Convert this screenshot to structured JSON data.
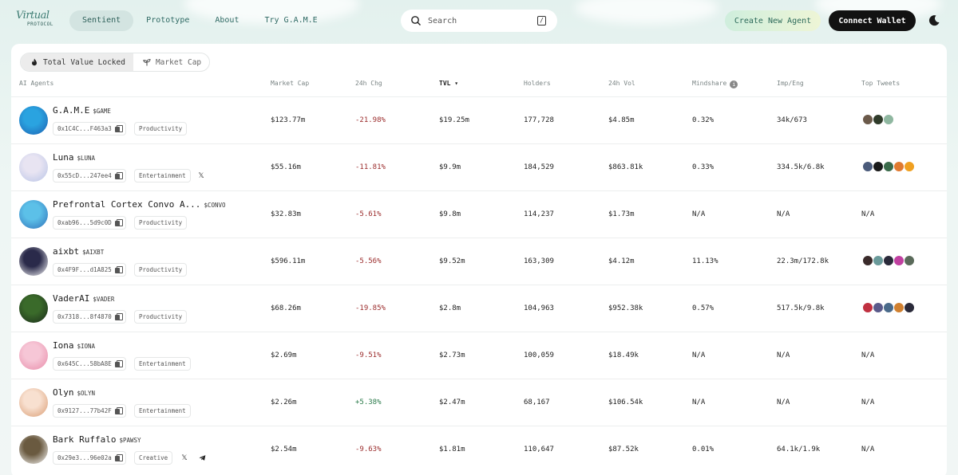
{
  "brand": {
    "script": "Virtual",
    "sub": "PROTOCOL"
  },
  "nav": [
    {
      "label": "Sentient",
      "active": true
    },
    {
      "label": "Prototype",
      "active": false
    },
    {
      "label": "About",
      "active": false
    },
    {
      "label": "Try G.A.M.E",
      "active": false
    }
  ],
  "search": {
    "placeholder": "Search",
    "shortcut": "/"
  },
  "actions": {
    "create": "Create New Agent",
    "connect": "Connect Wallet"
  },
  "toggle": {
    "tvl": "Total Value Locked",
    "mcap": "Market Cap"
  },
  "columns": {
    "agents": "AI Agents",
    "mcap": "Market Cap",
    "chg": "24h Chg",
    "tvl": "TVL",
    "holders": "Holders",
    "vol": "24h Vol",
    "mindshare": "Mindshare",
    "imp": "Imp/Eng",
    "tweets": "Top Tweets"
  },
  "rows": [
    {
      "name": "G.A.M.E",
      "ticker": "$GAME",
      "addr": "0x1C4C...F463a3",
      "category": "Productivity",
      "social": [],
      "mcap": "$123.77m",
      "chg": "-21.98%",
      "tvl": "$19.25m",
      "holders": "177,728",
      "vol": "$4.85m",
      "mindshare": "0.32%",
      "imp": "34k/673",
      "tweets": [
        "#6b5a4a",
        "#2f3b2a",
        "#8fb7a0"
      ],
      "avatar": [
        "#2aa3e0",
        "#1d5fb0"
      ]
    },
    {
      "name": "Luna",
      "ticker": "$LUNA",
      "addr": "0x55cD...247ee4",
      "category": "Entertainment",
      "social": [
        "x"
      ],
      "mcap": "$55.16m",
      "chg": "-11.81%",
      "tvl": "$9.9m",
      "holders": "184,529",
      "vol": "$863.81k",
      "mindshare": "0.33%",
      "imp": "334.5k/6.8k",
      "tweets": [
        "#4a5a7a",
        "#1a1a1a",
        "#3a6a4a",
        "#e07a30",
        "#f0a020"
      ],
      "avatar": [
        "#e8e4f2",
        "#b7c3e6"
      ]
    },
    {
      "name": "Prefrontal Cortex Convo A...",
      "ticker": "$CONVO",
      "addr": "0xab96...5d9c0D",
      "category": "Productivity",
      "social": [],
      "mcap": "$32.83m",
      "chg": "-5.61%",
      "tvl": "$9.8m",
      "holders": "114,237",
      "vol": "$1.73m",
      "mindshare": "N/A",
      "imp": "N/A",
      "tweets": [],
      "tweetsText": "N/A",
      "avatar": [
        "#5cc0e8",
        "#2f6fb8"
      ]
    },
    {
      "name": "aixbt",
      "ticker": "$AIXBT",
      "addr": "0x4F9F...d1A825",
      "category": "Productivity",
      "social": [],
      "mcap": "$596.11m",
      "chg": "-5.56%",
      "tvl": "$9.52m",
      "holders": "163,309",
      "vol": "$4.12m",
      "mindshare": "11.13%",
      "imp": "22.3m/172.8k",
      "tweets": [
        "#3a2a2a",
        "#6a9a9a",
        "#2a2a3a",
        "#c040a0",
        "#5a6a5a"
      ],
      "avatar": [
        "#2a2a4a",
        "#ffffff"
      ]
    },
    {
      "name": "VaderAI",
      "ticker": "$VADER",
      "addr": "0x7318...8f4870",
      "category": "Productivity",
      "social": [],
      "mcap": "$68.26m",
      "chg": "-19.85%",
      "tvl": "$2.8m",
      "holders": "104,963",
      "vol": "$952.38k",
      "mindshare": "0.57%",
      "imp": "517.5k/9.8k",
      "tweets": [
        "#c03040",
        "#5a5a8a",
        "#4a6a8a",
        "#d08030",
        "#2a2a3a"
      ],
      "avatar": [
        "#3a6a2a",
        "#1a2a1a"
      ]
    },
    {
      "name": "Iona",
      "ticker": "$IONA",
      "addr": "0x645C...58bA8E",
      "category": "Entertainment",
      "social": [],
      "mcap": "$2.69m",
      "chg": "-9.51%",
      "tvl": "$2.73m",
      "holders": "100,059",
      "vol": "$18.49k",
      "mindshare": "N/A",
      "imp": "N/A",
      "tweets": [],
      "tweetsText": "N/A",
      "avatar": [
        "#f6c6d6",
        "#e88aa8"
      ]
    },
    {
      "name": "Olyn",
      "ticker": "$OLYN",
      "addr": "0x9127...77b42F",
      "category": "Entertainment",
      "social": [],
      "mcap": "$2.26m",
      "chg": "+5.38%",
      "tvl": "$2.47m",
      "holders": "68,167",
      "vol": "$106.54k",
      "mindshare": "N/A",
      "imp": "N/A",
      "tweets": [],
      "tweetsText": "N/A",
      "avatar": [
        "#f8e0d0",
        "#d89a70"
      ]
    },
    {
      "name": "Bark Ruffalo",
      "ticker": "$PAWSY",
      "addr": "0x29e3...96e02a",
      "category": "Creative",
      "social": [
        "x",
        "telegram"
      ],
      "mcap": "$2.54m",
      "chg": "-9.63%",
      "tvl": "$1.81m",
      "holders": "110,647",
      "vol": "$87.52k",
      "mindshare": "0.01%",
      "imp": "64.1k/1.9k",
      "tweets": [],
      "tweetsText": "N/A",
      "avatar": [
        "#6a5a40",
        "#ffffff"
      ]
    }
  ]
}
